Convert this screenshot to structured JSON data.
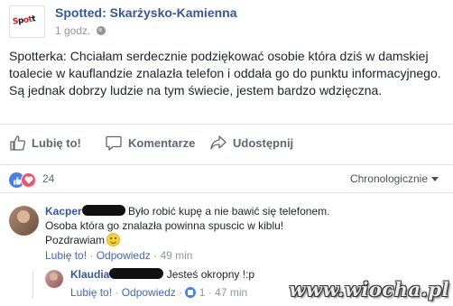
{
  "post": {
    "page_name": "Spotted: Skarżysko-Kamienna",
    "time": "1 godz.",
    "avatar_logo": "Spotted",
    "text": "Spotterka: Chciałam serdecznie podziękować osobie która dziś w damskiej toalecie w kauflandzie znalazła telefon i oddała go do punktu informacyjnego. Są jednak dobrzy ludzie na tym świecie, jestem bardzo wdzięczna."
  },
  "actions": {
    "like": "Lubię to!",
    "comment": "Komentarze",
    "share": "Udostępnij"
  },
  "reactions": {
    "count": "24",
    "order": "Chronologicznie"
  },
  "comments": [
    {
      "name": "Kacper",
      "text_line1": "Było robić kupę a nie bawić się telefonem.",
      "text_line2": "Osoba która go znalazła powinna spuscic w kiblu!",
      "text_line3": "Pozdrawiam",
      "like_link": "Lubię to!",
      "reply_link": "Odpowiedz",
      "time": "49 min"
    },
    {
      "name": "Klaudia",
      "text": "Jesteś okropny !:p",
      "like_link": "Lubię to!",
      "reply_link": "Odpowiedz",
      "likes": "1",
      "time": "47 min"
    }
  ],
  "watermark": "www.wiocha.pl",
  "colors": {
    "link": "#365899",
    "like_blue": "#4a7fe6",
    "love_red": "#f25268",
    "muted": "#90949c"
  }
}
